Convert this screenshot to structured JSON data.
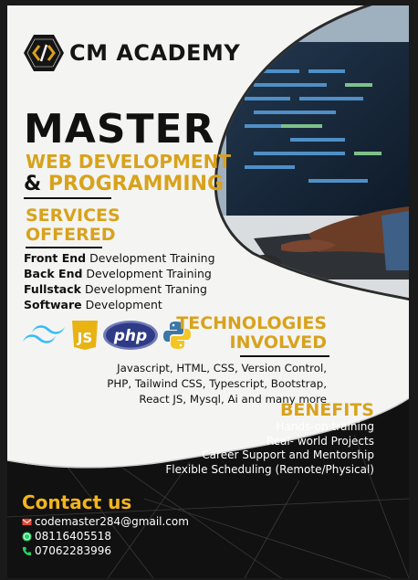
{
  "brand": {
    "name": "CM ACADEMY"
  },
  "headline": {
    "line1": "MASTER",
    "line2": "WEB DEVELOPMENT",
    "amp": "&",
    "line3": "PROGRAMMING"
  },
  "services": {
    "title1": "SERVICES",
    "title2": "OFFERED",
    "items": [
      {
        "bold": "Front End",
        "rest": " Development Training"
      },
      {
        "bold": "Back End",
        "rest": " Development Training"
      },
      {
        "bold": "Fullstack",
        "rest": " Development Traning"
      },
      {
        "bold": "Software",
        "rest": " Development"
      }
    ]
  },
  "technologies": {
    "title1": "TECHNOLOGIES",
    "title2": "INVOLVED",
    "lines": [
      "Javascript, HTML, CSS, Version Control,",
      "PHP, Tailwind CSS, Typescript, Bootstrap,",
      "React JS, Mysql, Ai and many more"
    ],
    "icons": [
      "tailwind-icon",
      "javascript-icon",
      "php-icon",
      "python-icon"
    ],
    "js_label": "JS",
    "php_label": "php"
  },
  "benefits": {
    "title": "BENEFITS",
    "items": [
      "Hands-on training",
      "Real- world Projects",
      "Career Support and Mentorship",
      "Flexible Scheduling (Remote/Physical)"
    ]
  },
  "contact": {
    "title": "Contact us",
    "email": "codemaster284@gmail.com",
    "whatsapp": "08116405518",
    "phone": "07062283996"
  },
  "colors": {
    "accent": "#d8a21c",
    "dark": "#111111",
    "light": "#f4f4f2"
  }
}
